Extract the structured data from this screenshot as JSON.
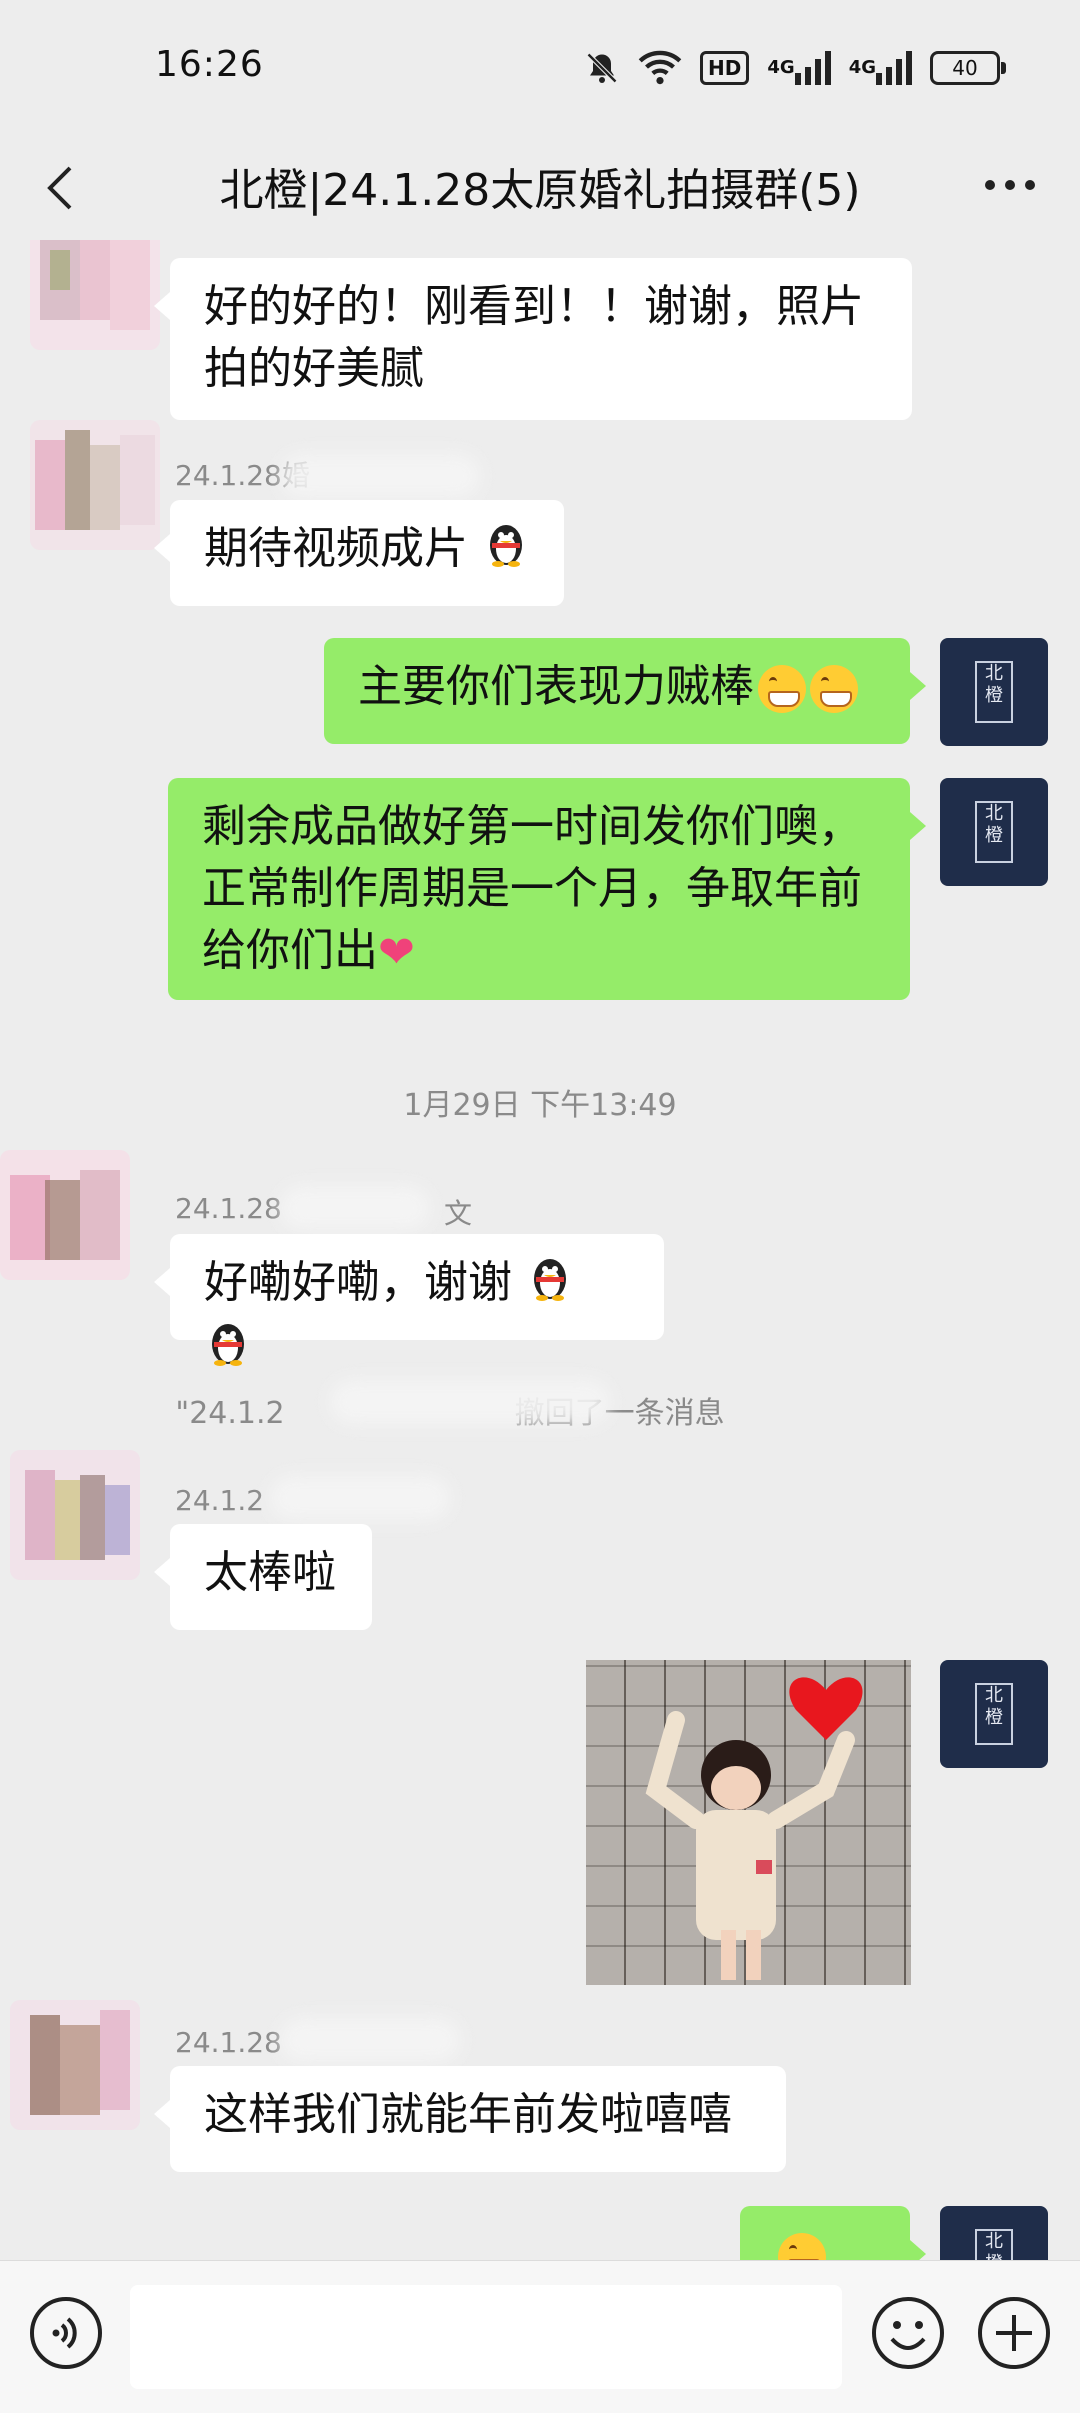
{
  "status_bar": {
    "time": "16:26",
    "hd_label": "HD",
    "net1": "4G",
    "net2": "4G",
    "battery": "40"
  },
  "nav": {
    "title": "北橙|24.1.28太原婚礼拍摄群(5)"
  },
  "messages": [
    {
      "side": "left",
      "text": "好的好的！刚看到！！谢谢，照片拍的好美腻"
    },
    {
      "side": "left",
      "sender": "24.1.28婚",
      "text": "期待视频成片"
    },
    {
      "side": "right",
      "text": "主要你们表现力贼棒"
    },
    {
      "side": "right",
      "text": "剩余成品做好第一时间发你们噢，正常制作周期是一个月，争取年前给你们出"
    },
    {
      "type": "timestamp",
      "text": "1月29日 下午13:49"
    },
    {
      "side": "left",
      "sender": "24.1.28",
      "sender_tail": "文",
      "text": "好嘞好嘞，谢谢"
    },
    {
      "type": "system",
      "prefix": "\"24.1.2",
      "suffix": "撤回了一条消息"
    },
    {
      "side": "left",
      "sender": "24.1.2",
      "text": "太棒啦"
    },
    {
      "side": "right",
      "type": "image"
    },
    {
      "side": "left",
      "sender": "24.1.28",
      "text": "这样我们就能年前发啦嘻嘻"
    }
  ],
  "texts": {
    "m1_line1": "好的好的！刚看到！！谢谢，照片",
    "m1_line2": "拍的好美腻",
    "m2_sender": "24.1.28婚",
    "m2_text": "期待视频成片",
    "m3_text": "主要你们表现力贼棒",
    "m4_line1": "剩余成品做好第一时间发你们噢，",
    "m4_line2": "正常制作周期是一个月，争取年前",
    "m4_line3": "给你们出",
    "timestamp": "1月29日 下午13:49",
    "m5_sender": "24.1.28",
    "m5_sender_tail": "文",
    "m5_text": "好嘞好嘞，谢谢",
    "recall_prefix": "\"24.1.2",
    "recall_suffix": "撤回了一条消息",
    "m6_sender": "24.1.2",
    "m6_text": "太棒啦",
    "m8_sender": "24.1.28",
    "m8_text": "这样我们就能年前发啦嘻嘻"
  },
  "avatar_seal": "北橙",
  "colors": {
    "background": "#ededed",
    "bubble_self": "#95ec69",
    "bubble_other": "#ffffff",
    "avatar_self": "#1f2d4a"
  },
  "input": {
    "placeholder": ""
  }
}
